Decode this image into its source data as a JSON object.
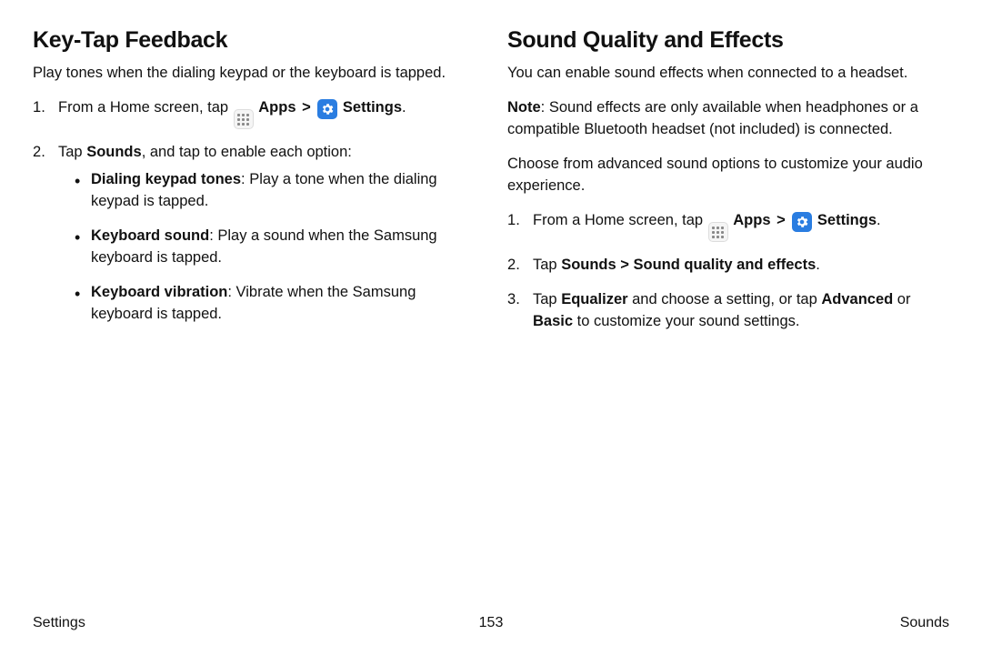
{
  "left": {
    "heading": "Key-Tap Feedback",
    "intro": "Play tones when the dialing keypad or the keyboard is tapped.",
    "step1_pre": "From a Home screen, tap ",
    "apps_label": "Apps",
    "settings_label": "Settings",
    "chevron": ">",
    "period": ".",
    "step2_pre": "Tap ",
    "step2_bold": "Sounds",
    "step2_post": ", and tap to enable each option:",
    "bullets": [
      {
        "bold": "Dialing keypad tones",
        "rest": ": Play a tone when the dialing keypad is tapped."
      },
      {
        "bold": "Keyboard sound",
        "rest": ": Play a sound when the Samsung keyboard is tapped."
      },
      {
        "bold": "Keyboard vibration",
        "rest": ": Vibrate when the Samsung keyboard is tapped."
      }
    ]
  },
  "right": {
    "heading": "Sound Quality and Effects",
    "intro": "You can enable sound effects when connected to a headset.",
    "note_bold": "Note",
    "note_rest": ": Sound effects are only available when headphones or a compatible Bluetooth headset (not included) is connected.",
    "choose": "Choose from advanced sound options to customize your audio experience.",
    "step1_pre": "From a Home screen, tap ",
    "apps_label": "Apps",
    "settings_label": "Settings",
    "chevron": ">",
    "period": ".",
    "step2_pre": "Tap ",
    "step2_bold": "Sounds > Sound quality and effects",
    "step2_post": ".",
    "step3_pre": "Tap ",
    "step3_b1": "Equalizer",
    "step3_mid1": " and choose a setting, or tap ",
    "step3_b2": "Advanced",
    "step3_mid2": " or ",
    "step3_b3": "Basic",
    "step3_post": " to customize your sound settings."
  },
  "footer": {
    "left": "Settings",
    "center": "153",
    "right": "Sounds"
  }
}
